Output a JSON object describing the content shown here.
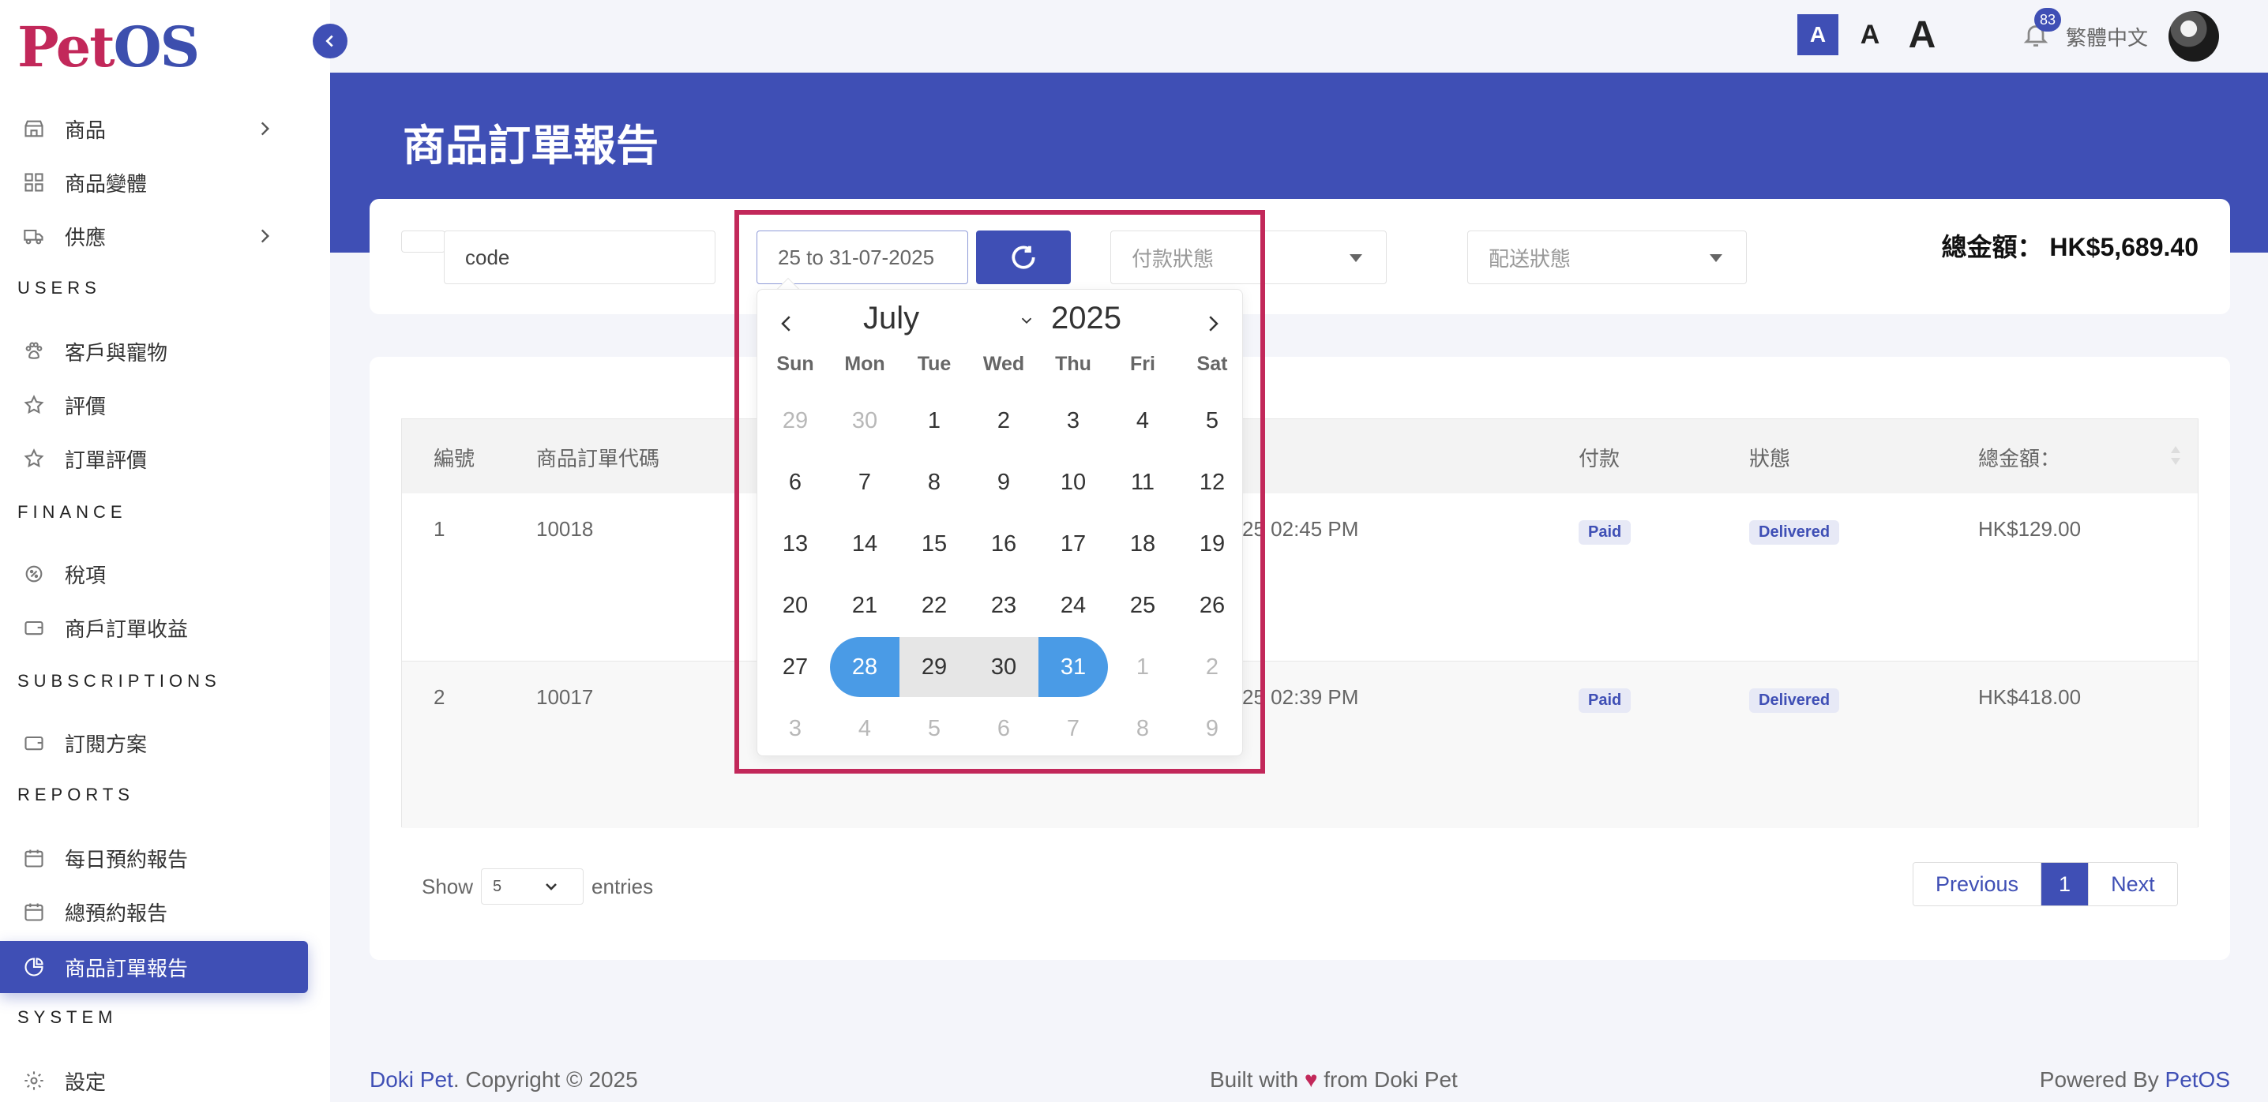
{
  "app": {
    "logo_p": "P",
    "logo_et": "et",
    "logo_os": "OS"
  },
  "sidebar": {
    "items": [
      {
        "label": "商品",
        "icon": "shop-icon",
        "chevron": true
      },
      {
        "label": "商品變體",
        "icon": "grid-icon",
        "chevron": false
      },
      {
        "label": "供應",
        "icon": "truck-icon",
        "chevron": true
      },
      {
        "label": "客戶與寵物",
        "icon": "paw-icon",
        "chevron": false
      },
      {
        "label": "評價",
        "icon": "star-icon",
        "chevron": false
      },
      {
        "label": "訂單評價",
        "icon": "star-icon",
        "chevron": false
      },
      {
        "label": "稅項",
        "icon": "tax-icon",
        "chevron": false
      },
      {
        "label": "商戶訂單收益",
        "icon": "wallet-icon",
        "chevron": false
      },
      {
        "label": "訂閱方案",
        "icon": "wallet-icon",
        "chevron": false
      },
      {
        "label": "每日預約報告",
        "icon": "calendar-icon",
        "chevron": false
      },
      {
        "label": "總預約報告",
        "icon": "calendar-icon",
        "chevron": false
      },
      {
        "label": "商品訂單報告",
        "icon": "pie-chart-icon",
        "chevron": false,
        "active": true
      },
      {
        "label": "設定",
        "icon": "gear-icon",
        "chevron": false
      }
    ],
    "sections": {
      "users": "USERS",
      "finance": "FINANCE",
      "subscriptions": "SUBSCRIPTIONS",
      "reports": "REPORTS",
      "system": "SYSTEM"
    }
  },
  "header": {
    "font_size_labels": [
      "A",
      "A",
      "A"
    ],
    "notification_count": "83",
    "language": "繁體中文"
  },
  "page": {
    "title": "商品訂單報告"
  },
  "filters": {
    "code_value": "code",
    "date_value": "25 to 31-07-2025",
    "payment_placeholder": "付款狀態",
    "shipping_placeholder": "配送狀態",
    "total_label": "總金額：",
    "total_value": "HK$5,689.40"
  },
  "datepicker": {
    "month": "July",
    "year": "2025",
    "weekdays": [
      "Sun",
      "Mon",
      "Tue",
      "Wed",
      "Thu",
      "Fri",
      "Sat"
    ],
    "weeks": [
      [
        [
          "29",
          "muted"
        ],
        [
          "30",
          "muted"
        ],
        [
          "1",
          ""
        ],
        [
          "2",
          ""
        ],
        [
          "3",
          ""
        ],
        [
          "4",
          ""
        ],
        [
          "5",
          ""
        ]
      ],
      [
        [
          "6",
          ""
        ],
        [
          "7",
          ""
        ],
        [
          "8",
          ""
        ],
        [
          "9",
          ""
        ],
        [
          "10",
          ""
        ],
        [
          "11",
          ""
        ],
        [
          "12",
          ""
        ]
      ],
      [
        [
          "13",
          ""
        ],
        [
          "14",
          ""
        ],
        [
          "15",
          ""
        ],
        [
          "16",
          ""
        ],
        [
          "17",
          ""
        ],
        [
          "18",
          ""
        ],
        [
          "19",
          ""
        ]
      ],
      [
        [
          "20",
          ""
        ],
        [
          "21",
          ""
        ],
        [
          "22",
          ""
        ],
        [
          "23",
          ""
        ],
        [
          "24",
          ""
        ],
        [
          "25",
          ""
        ],
        [
          "26",
          ""
        ]
      ],
      [
        [
          "27",
          ""
        ],
        [
          "28",
          "sel-start"
        ],
        [
          "29",
          "inrange"
        ],
        [
          "30",
          "inrange"
        ],
        [
          "31",
          "sel-end"
        ],
        [
          "1",
          "muted"
        ],
        [
          "2",
          "muted"
        ]
      ],
      [
        [
          "3",
          "muted"
        ],
        [
          "4",
          "muted"
        ],
        [
          "5",
          "muted"
        ],
        [
          "6",
          "muted"
        ],
        [
          "7",
          "muted"
        ],
        [
          "8",
          "muted"
        ],
        [
          "9",
          "muted"
        ]
      ]
    ],
    "accent": "#4a9be6"
  },
  "table": {
    "headers": {
      "no": "編號",
      "code": "商品訂單代碼",
      "payment": "付款",
      "status": "狀態",
      "total": "總金額："
    },
    "rows": [
      {
        "no": "1",
        "code": "10018",
        "date_fragment": "25 02:45 PM",
        "payment": "Paid",
        "status": "Delivered",
        "total": "HK$129.00"
      },
      {
        "no": "2",
        "code": "10017",
        "date_fragment": "25 02:39 PM",
        "payment": "Paid",
        "status": "Delivered",
        "total": "HK$418.00"
      }
    ],
    "show_label": "Show",
    "entries_value": "5",
    "entries_label": "entries",
    "pager": {
      "prev": "Previous",
      "current": "1",
      "next": "Next"
    }
  },
  "footer": {
    "brand": "Doki Pet",
    "copyright": ". Copyright © 2025",
    "built_pre": "Built with ",
    "heart": "♥",
    "built_post": " from Doki Pet",
    "powered_pre": "Powered By ",
    "powered_brand": "PetOS"
  },
  "colors": {
    "primary": "#3f4fb5",
    "brand_red": "#c2285a",
    "highlight_border": "#c2285a"
  }
}
